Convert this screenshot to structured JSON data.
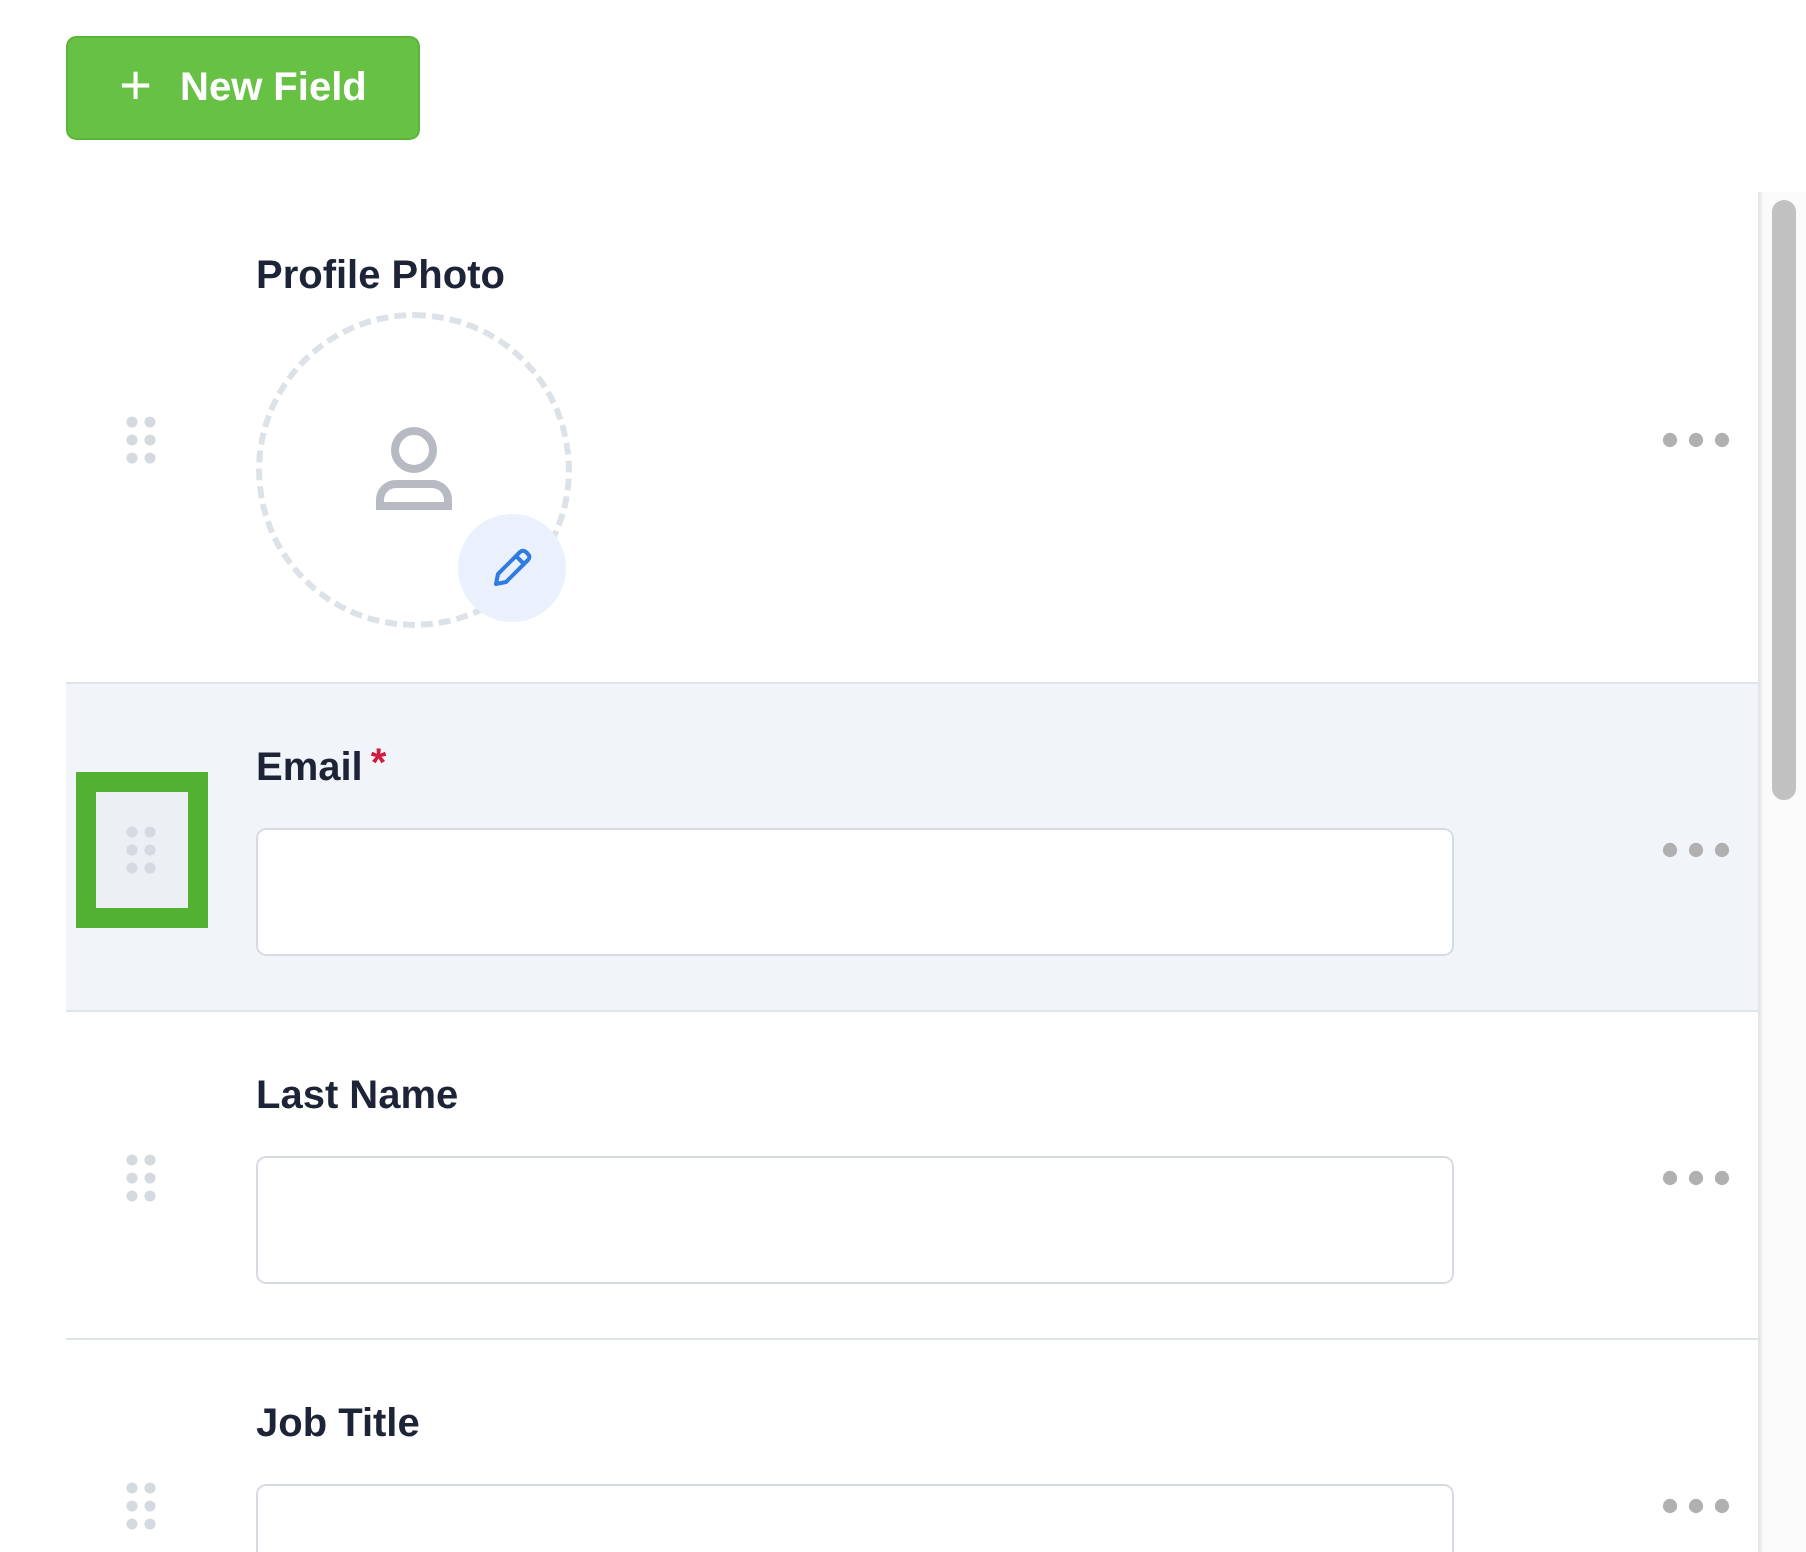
{
  "toolbar": {
    "new_field_button": {
      "icon": "+",
      "label": "New Field"
    }
  },
  "fields": [
    {
      "kind": "photo",
      "label": "Profile Photo",
      "selected": false,
      "highlighted": false
    },
    {
      "kind": "text",
      "label": "Email",
      "required_mark": "*",
      "selected": true,
      "highlighted": true
    },
    {
      "kind": "text",
      "label": "Last Name",
      "selected": false,
      "highlighted": false
    },
    {
      "kind": "text",
      "label": "Job Title",
      "selected": false,
      "highlighted": false
    }
  ]
}
